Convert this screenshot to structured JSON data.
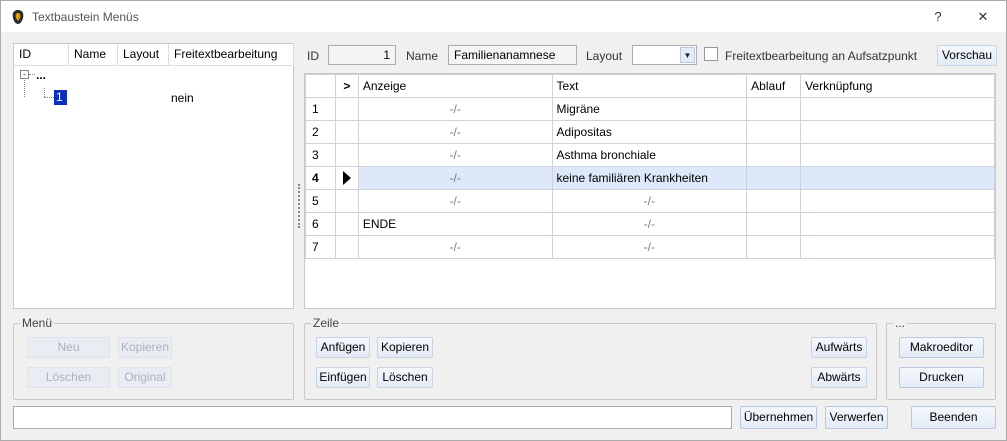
{
  "window": {
    "title": "Textbaustein Menüs",
    "help": "?",
    "close": "✕"
  },
  "tree": {
    "headers": [
      "ID",
      "Name",
      "Layout",
      "Freitextbearbeitung"
    ],
    "root_label": "...",
    "node_id": "1",
    "node_freitext": "nein"
  },
  "form": {
    "id_label": "ID",
    "id_value": "1",
    "name_label": "Name",
    "name_value": "Familienanamnese",
    "layout_label": "Layout",
    "layout_value": "",
    "checkbox_label": "Freitextbearbeitung an Aufsatzpunkt",
    "preview_label": "Vorschau"
  },
  "grid": {
    "headers": {
      "marker": ">",
      "anzeige": "Anzeige",
      "text": "Text",
      "ablauf": "Ablauf",
      "verknuepfung": "Verknüpfung"
    },
    "rows": [
      {
        "n": "1",
        "anzeige": "-/-",
        "text": "Migräne",
        "ablauf": "",
        "verkn": ""
      },
      {
        "n": "2",
        "anzeige": "-/-",
        "text": "Adipositas",
        "ablauf": "",
        "verkn": ""
      },
      {
        "n": "3",
        "anzeige": "-/-",
        "text": "Asthma bronchiale",
        "ablauf": "",
        "verkn": ""
      },
      {
        "n": "4",
        "anzeige": "-/-",
        "text": "keine familiären Krankheiten",
        "ablauf": "",
        "verkn": ""
      },
      {
        "n": "5",
        "anzeige": "-/-",
        "text": "-/-",
        "ablauf": "",
        "verkn": ""
      },
      {
        "n": "6",
        "anzeige": "ENDE",
        "text": "-/-",
        "ablauf": "",
        "verkn": ""
      },
      {
        "n": "7",
        "anzeige": "-/-",
        "text": "-/-",
        "ablauf": "",
        "verkn": ""
      }
    ]
  },
  "menu_group": {
    "label": "Menü",
    "neu": "Neu",
    "kopieren": "Kopieren",
    "loeschen": "Löschen",
    "original": "Original"
  },
  "zeile_group": {
    "label": "Zeile",
    "anfuegen": "Anfügen",
    "kopieren": "Kopieren",
    "einfuegen": "Einfügen",
    "loeschen": "Löschen",
    "aufwaerts": "Aufwärts",
    "abwaerts": "Abwärts"
  },
  "extra_group": {
    "label": "...",
    "makroeditor": "Makroeditor",
    "drucken": "Drucken"
  },
  "footer": {
    "status": "",
    "uebernehmen": "Übernehmen",
    "verwerfen": "Verwerfen",
    "beenden": "Beenden"
  }
}
